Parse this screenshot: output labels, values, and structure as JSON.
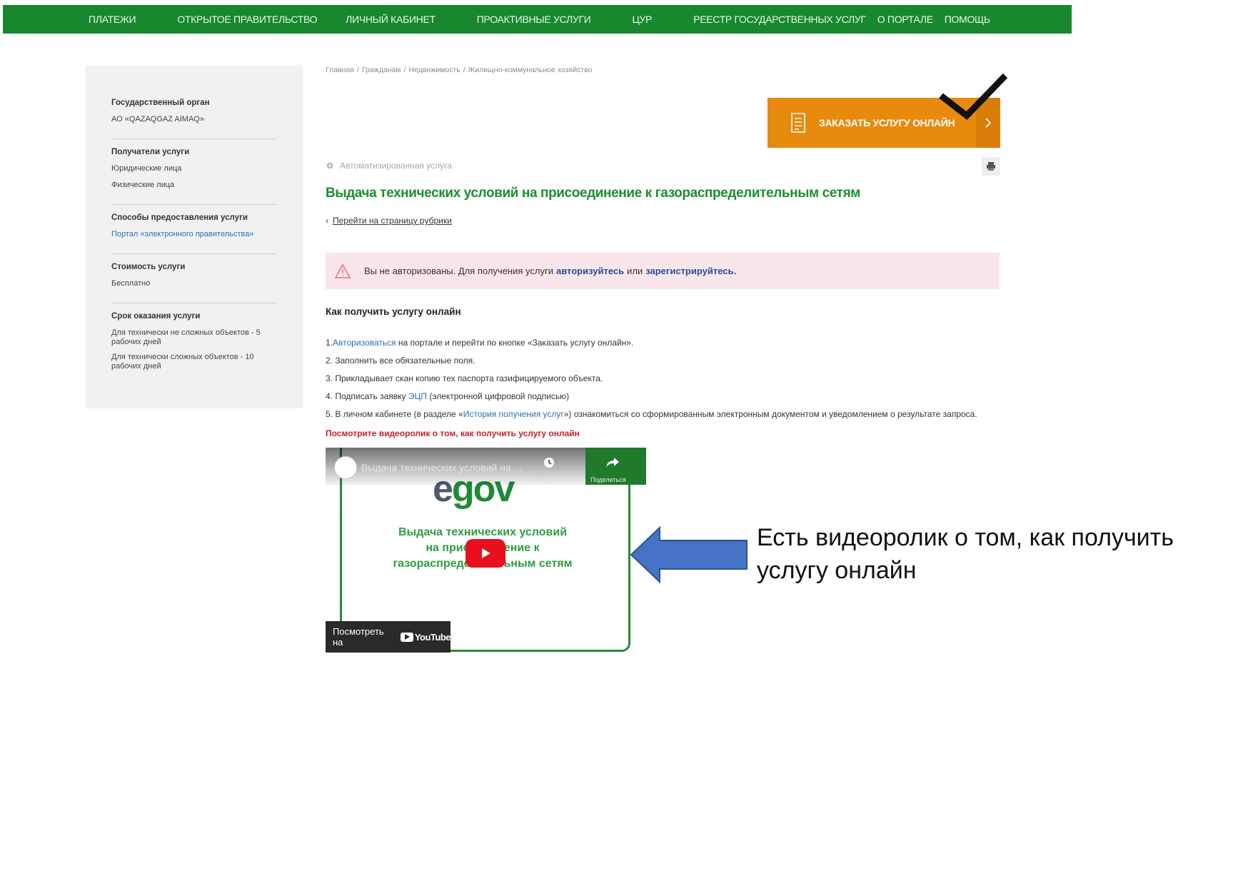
{
  "nav": [
    "ПЛАТЕЖИ",
    "ОТКРЫТОЕ ПРАВИТЕЛЬСТВО",
    "ЛИЧНЫЙ КАБИНЕТ",
    "ПРОАКТИВНЫЕ УСЛУГИ",
    "ЦУР",
    "РЕЕСТР ГОСУДАРСТВЕННЫХ УСЛУГ",
    "О ПОРТАЛЕ",
    "ПОМОЩЬ"
  ],
  "sidebar": {
    "groups": [
      {
        "title": "Государственный орган",
        "values": [
          "АО «QAZAQGAZ AIMAQ»"
        ]
      },
      {
        "title": "Получатели услуги",
        "values": [
          "Юридические лица",
          "Физические лица"
        ]
      },
      {
        "title": "Способы предоставления услуги",
        "values": [
          "Портал «электронного правительства»"
        ]
      },
      {
        "title": "Стоимость услуги",
        "values": [
          "Бесплатно"
        ]
      },
      {
        "title": "Срок оказания услуги",
        "values": [
          "Для технически не сложных объектов - 5 рабочих дней",
          "Для технически сложных объектов - 10 рабочих дней"
        ]
      }
    ]
  },
  "breadcrumb": [
    "Главная",
    "Гражданам",
    "Недвижимость",
    "Жилищно-коммунальное хозяйство"
  ],
  "order_button": {
    "label": "ЗАКАЗАТЬ УСЛУГУ ОНЛАЙН",
    "color": "#e78a0e"
  },
  "automated_label": "Автоматизированная услуга",
  "title": "Выдача технических условий на присоединение к газораспределительным сетям",
  "back_link": "Перейти на страницу рубрики",
  "alert": {
    "text_before": "Вы не авторизованы. Для получения услуги",
    "link_login": "авторизуйтесь",
    "text_or": "или",
    "link_register": "зарегистрируйтесь."
  },
  "how_title": "Как получить услугу онлайн",
  "steps": {
    "s1_prefix": "1.",
    "s1_link": "Авторизоваться",
    "s1_rest": "на портале и перейти по кнопке «Заказать услугу онлайн».",
    "s2": "2. Заполнить все обязательные поля.",
    "s3": "3. Прикладывает скан копию тех паспорта газифицируемого объекта.",
    "s4_prefix": "4. Подписать заявку",
    "s4_link": "ЭЦП",
    "s4_rest": "(электронной цифровой подписью)",
    "s5_prefix": "5. В личном кабинете (в разделе «",
    "s5_link": "История получения услуг",
    "s5_rest": "») ознакомиться со сформированным электронным документом и уведомлением о результате запроса."
  },
  "video_caption": "Посмотрите видеоролик о том, как получить услугу онлайн",
  "video": {
    "title": "Выдача технических условий на ...",
    "watch_later": "Смотреть...",
    "share": "Поделиться",
    "logo_e": "e",
    "logo_gov": "gov",
    "text_lines": [
      "Выдача технических условий",
      "на присоединение к",
      "газораспределительным сетям"
    ],
    "watch_on": "Посмотреть на",
    "youtube": "YouTube"
  },
  "annotation": "Есть видеоролик о том, как получить услугу онлайн",
  "colors": {
    "nav_green": "#17882d",
    "title_green": "#1a8f2f",
    "arrow_blue": "#4472c4",
    "alert_bg": "#f9e6ea"
  }
}
